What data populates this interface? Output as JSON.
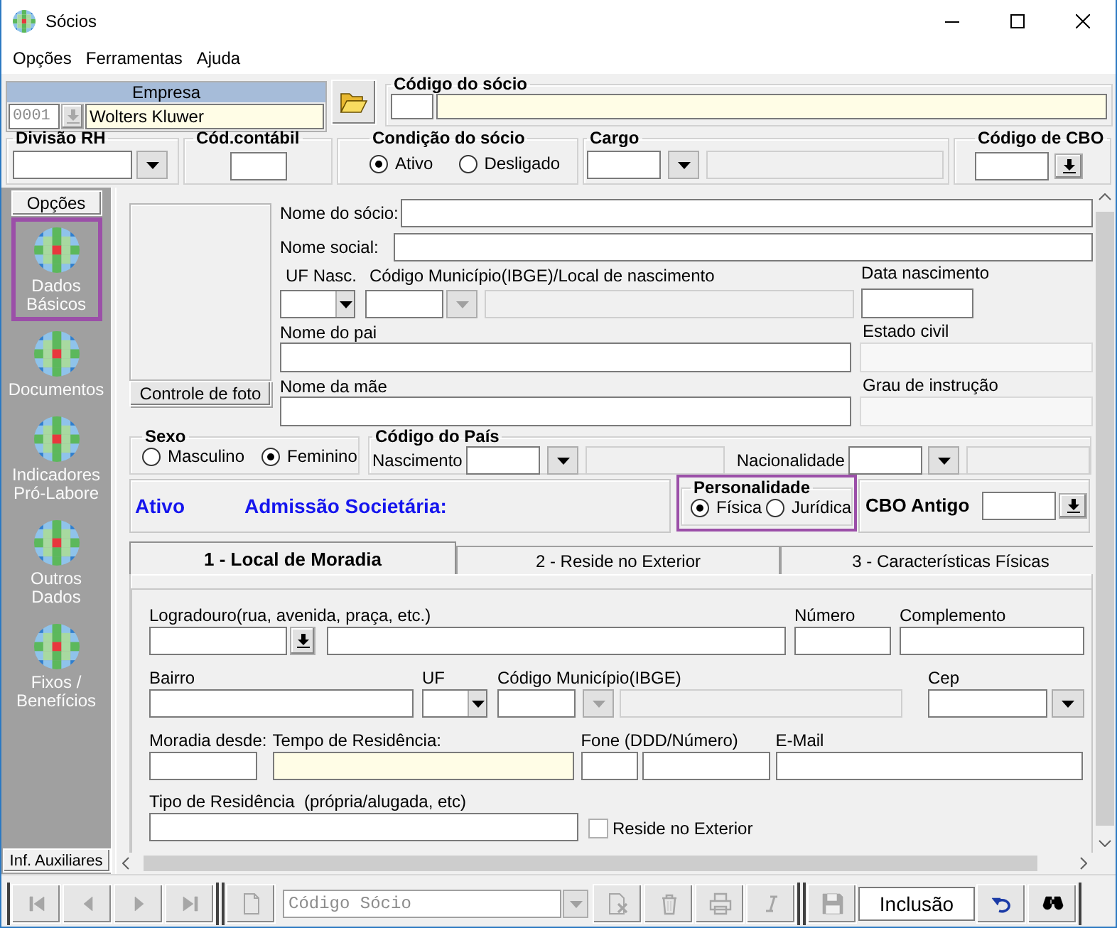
{
  "window": {
    "title": "Sócios"
  },
  "menu": [
    {
      "label": "Opções"
    },
    {
      "label": "Ferramentas"
    },
    {
      "label": "Ajuda"
    }
  ],
  "empresa": {
    "label": "Empresa",
    "code": "0001",
    "name": "Wolters Kluwer"
  },
  "codigo_socio": {
    "label": "Código do sócio"
  },
  "divisao_rh": {
    "label": "Divisão RH"
  },
  "cod_contabil": {
    "label": "Cód.contábil"
  },
  "condicao": {
    "label": "Condição do sócio",
    "options": [
      {
        "label": "Ativo",
        "selected": true
      },
      {
        "label": "Desligado",
        "selected": false
      }
    ]
  },
  "cargo": {
    "label": "Cargo"
  },
  "codigo_cbo": {
    "label": "Código de CBO"
  },
  "sidebar": {
    "header": "Opções",
    "items": [
      {
        "label": "Dados\nBásicos",
        "selected": true
      },
      {
        "label": "Documentos",
        "selected": false
      },
      {
        "label": "Indicadores\nPró-Labore",
        "selected": false
      },
      {
        "label": "Outros\nDados",
        "selected": false
      },
      {
        "label": "Fixos /\nBenefícios",
        "selected": false
      }
    ],
    "footer": "Inf. Auxiliares"
  },
  "dados": {
    "photo_button": "Controle de foto",
    "nome_socio": "Nome do sócio:",
    "nome_social": "Nome social:",
    "uf_nasc": "UF Nasc.",
    "municipio": "Código Município(IBGE)/Local de nascimento",
    "data_nascimento": "Data nascimento",
    "nome_pai": "Nome do pai",
    "estado_civil": "Estado civil",
    "nome_mae": "Nome da mãe",
    "grau_instrucao": "Grau de instrução"
  },
  "sexo": {
    "label": "Sexo",
    "options": [
      {
        "label": "Masculino",
        "selected": false
      },
      {
        "label": "Feminino",
        "selected": true
      }
    ]
  },
  "codigo_pais": {
    "label": "Código do País",
    "nascimento": "Nascimento",
    "nacionalidade": "Nacionalidade"
  },
  "status": {
    "situacao": "Ativo",
    "admissao": "Admissão Societária:"
  },
  "personalidade": {
    "label": "Personalidade",
    "highlighted": true,
    "options": [
      {
        "label": "Física",
        "selected": true
      },
      {
        "label": "Jurídica",
        "selected": false
      }
    ]
  },
  "cbo_antigo": {
    "label": "CBO Antigo"
  },
  "tabs": [
    {
      "label": "1 - Local de Moradia",
      "selected": true
    },
    {
      "label": "2 - Reside no Exterior",
      "selected": false
    },
    {
      "label": "3 - Características Físicas",
      "selected": false
    }
  ],
  "endereco": {
    "logradouro": "Logradouro(rua, avenida, praça, etc.)",
    "numero": "Número",
    "complemento": "Complemento",
    "bairro": "Bairro",
    "uf": "UF",
    "municipio": "Código Município(IBGE)",
    "cep": "Cep",
    "moradia_desde": "Moradia desde:",
    "tempo_residencia": "Tempo de Residência:",
    "fone": "Fone (DDD/Número)",
    "email": "E-Mail",
    "tipo_residencia": "Tipo de Residência  (própria/alugada, etc)",
    "reside_exterior": {
      "label": "Reside no Exterior",
      "checked": false
    }
  },
  "toolbar": {
    "nav": [
      {
        "kind": "first",
        "disabled": true
      },
      {
        "kind": "prev",
        "disabled": true
      },
      {
        "kind": "next",
        "disabled": true
      },
      {
        "kind": "last",
        "disabled": true
      }
    ],
    "new": {
      "kind": "new",
      "disabled": true
    },
    "search": {
      "placeholder": "Código Sócio"
    },
    "tools": [
      {
        "kind": "remove",
        "disabled": true
      },
      {
        "kind": "delete",
        "disabled": true
      },
      {
        "kind": "print",
        "disabled": true
      },
      {
        "kind": "italic",
        "disabled": true
      }
    ],
    "save": {
      "kind": "save",
      "disabled": true
    },
    "mode": "Inclusão",
    "actions": [
      {
        "kind": "undo",
        "disabled": false
      },
      {
        "kind": "find",
        "disabled": false
      }
    ]
  }
}
